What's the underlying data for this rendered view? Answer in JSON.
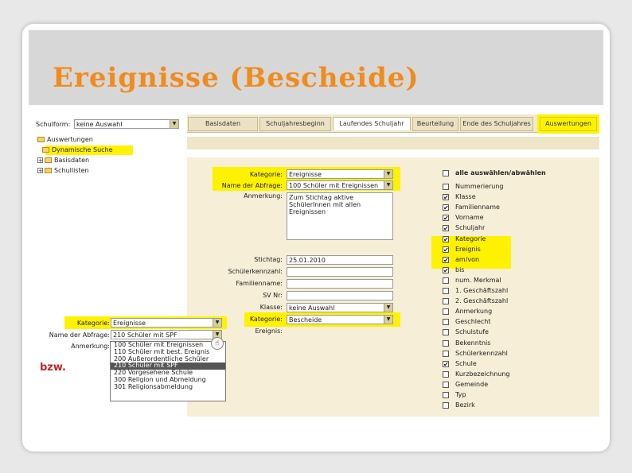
{
  "slide": {
    "title": "Ereignisse (Bescheide)",
    "footnote": "bzw."
  },
  "colors": {
    "title": "#f08b1e",
    "highlight": "#fff200",
    "footnote": "#c1272d"
  },
  "left_panel": {
    "top_label": "Schulform:",
    "top_value": "keine Auswahl",
    "tree": [
      "Auswertungen",
      "Dynamische Suche",
      "Basisdaten",
      "Schullisten"
    ]
  },
  "tabs_top": [
    "Basisdaten",
    "Schuljahresbeginn",
    "Laufendes Schuljahr",
    "Beurteilung",
    "Ende des Schuljahres",
    "Auswertungen"
  ],
  "tabs": [
    "Basisdaten",
    "Schuljahresbeginn",
    "Laufendes Schuljahr",
    "Beurteilung",
    "Ende des Schuljahres",
    "Auswertungen"
  ],
  "form": {
    "kategorie_label": "Kategorie:",
    "kategorie_value": "Ereignisse",
    "abfrage_label": "Name der Abfrage:",
    "abfrage_value": "100 Schüler mit Ereignissen",
    "anmerkung_label": "Anmerkung:",
    "anmerkung_value": "Zum Stichtag aktive\nSchülerInnen mit allen\nEreignissen",
    "stichtag_label": "Stichtag:",
    "stichtag_value": "25.01.2010",
    "kennzahl_label": "Schülerkennzahl:",
    "familienname_label": "Familienname:",
    "svnr_label": "SV Nr:",
    "klasse_label": "Klasse:",
    "klasse_value": "keine Auswahl",
    "kategorie2_label": "Kategorie:",
    "kategorie2_value": "Bescheide",
    "ereignis_label": "Ereignis:"
  },
  "columns": {
    "all_label": "alle auswählen/abwählen",
    "items": [
      {
        "label": "Nummerierung",
        "checked": false
      },
      {
        "label": "Klasse",
        "checked": true
      },
      {
        "label": "Familienname",
        "checked": true
      },
      {
        "label": "Vorname",
        "checked": true
      },
      {
        "label": "Schuljahr",
        "checked": true
      },
      {
        "label": "Kategorie",
        "checked": true
      },
      {
        "label": "Ereignis",
        "checked": true
      },
      {
        "label": "am/von",
        "checked": true
      },
      {
        "label": "bis",
        "checked": true
      },
      {
        "label": "num. Merkmal",
        "checked": false
      },
      {
        "label": "1. Geschäftszahl",
        "checked": false
      },
      {
        "label": "2. Geschäftszahl",
        "checked": false
      },
      {
        "label": "Anmerkung",
        "checked": false
      },
      {
        "label": "Geschlecht",
        "checked": false
      },
      {
        "label": "Schulstufe",
        "checked": false
      },
      {
        "label": "Bekenntnis",
        "checked": false
      },
      {
        "label": "Schülerkennzahl",
        "checked": false
      },
      {
        "label": "Schule",
        "checked": true
      },
      {
        "label": "Kurzbezeichnung",
        "checked": false
      },
      {
        "label": "Gemeinde",
        "checked": false
      },
      {
        "label": "Typ",
        "checked": false
      },
      {
        "label": "Bezirk",
        "checked": false
      }
    ]
  },
  "overlay": {
    "kategorie_label": "Kategorie:",
    "kategorie_value": "Ereignisse",
    "abfrage_label": "Name der Abfrage:",
    "abfrage_value": "210 Schüler mit SPF",
    "anmerkung_label": "Anmerkung:",
    "options": [
      "100 Schüler mit Ereignissen",
      "110 Schüler mit best. Ereignis",
      "200 Außerordentliche Schüler",
      "210 Schüler mit SPF",
      "220 Vorgesehene Schule",
      "300 Religion und Abmeldung",
      "301 Religionsabmeldung"
    ],
    "selected_index": 3
  }
}
